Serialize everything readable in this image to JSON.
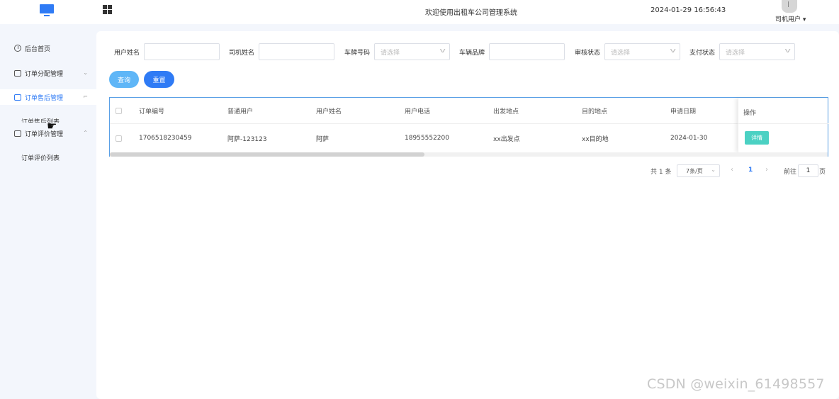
{
  "header": {
    "title": "欢迎使用出租车公司管理系统",
    "datetime": "2024-01-29 16:56:43",
    "user_label": "司机用户",
    "user_caret": "▾"
  },
  "sidebar": {
    "items": [
      {
        "label": "后台首页",
        "icon": "clock-icon"
      },
      {
        "label": "订单分配管理",
        "icon": "chart-icon",
        "arrow": "⌄"
      },
      {
        "label": "订单售后管理",
        "icon": "chart-icon",
        "arrow": "⌐"
      },
      {
        "label": "订单评价管理",
        "icon": "chart-icon",
        "arrow": "⌃"
      }
    ],
    "sub_after_sales": "订单售后列表",
    "sub_review": "订单评价列表"
  },
  "filters": {
    "user_name_label": "用户姓名",
    "driver_name_label": "司机姓名",
    "plate_label": "车牌号码",
    "plate_placeholder": "请选择",
    "brand_label": "车辆品牌",
    "audit_label": "审核状态",
    "audit_placeholder": "请选择",
    "pay_label": "支付状态",
    "pay_placeholder": "请选择"
  },
  "buttons": {
    "query": "查询",
    "reset": "重置"
  },
  "table": {
    "headers": [
      "订单编号",
      "普通用户",
      "用户姓名",
      "用户电话",
      "出发地点",
      "目的地点",
      "申请日期"
    ],
    "op_header": "操作",
    "rows": [
      [
        "1706518230459",
        "阿萨-123123",
        "阿萨",
        "18955552200",
        "xx出发点",
        "xx目的地",
        "2024-01-30"
      ]
    ],
    "detail_button": "详情",
    "scroll_position": 0.0
  },
  "pagination": {
    "total": "共 1 条",
    "page_size": "7条/页",
    "prev": "‹",
    "current_page": "1",
    "next": "›",
    "goto_prefix": "前往",
    "goto_value": "1",
    "goto_suffix": "页"
  },
  "watermark": "CSDN @weixin_61498557",
  "colors": {
    "primary": "#2f7bf5",
    "query_button": "#5fb6f7",
    "detail_button": "#4bd1c3"
  }
}
